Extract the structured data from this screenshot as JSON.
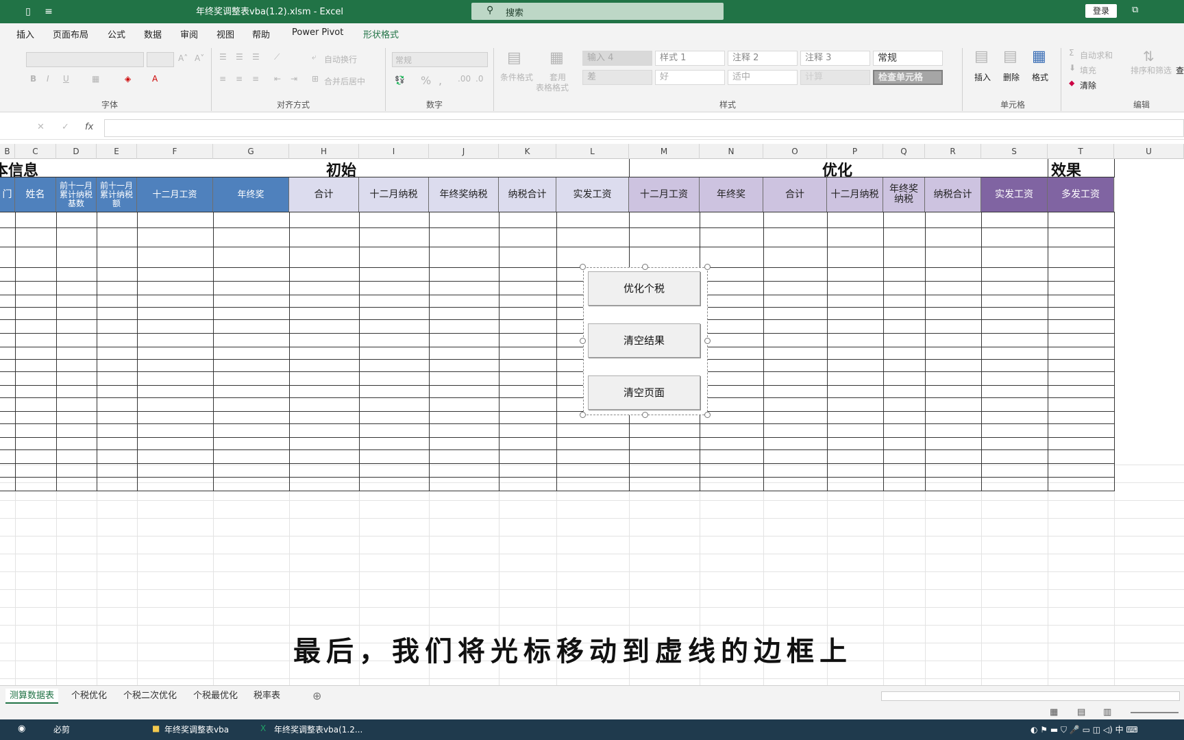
{
  "titlebar": {
    "doc_title": "年终奖调整表vba(1.2).xlsm  -  Excel",
    "search_placeholder": "搜索",
    "login": "登录"
  },
  "menu": [
    "插入",
    "页面布局",
    "公式",
    "数据",
    "审阅",
    "视图",
    "帮助",
    "Power Pivot",
    "形状格式"
  ],
  "ribbon": {
    "font_group": "字体",
    "align_group": "对齐方式",
    "number_group": "数字",
    "styles_group": "样式",
    "cells_group": "单元格",
    "edit_group": "编辑",
    "wrap_text": "自动换行",
    "merge_center": "合并后居中",
    "number_format": "常规",
    "cond_format": "条件格式",
    "table_format_1": "套用",
    "table_format_2": "表格格式",
    "styles": [
      {
        "label": "输入 4",
        "bg": "#d9d9d9"
      },
      {
        "label": "样式 1",
        "bg": "#ffffff"
      },
      {
        "label": "注释 2",
        "bg": "#ffffff"
      },
      {
        "label": "注释 3",
        "bg": "#ffffff"
      },
      {
        "label": "常规",
        "bg": "#ffffff"
      },
      {
        "label": "差",
        "bg": "#e6e6e6"
      },
      {
        "label": "好",
        "bg": "#ffffff"
      },
      {
        "label": "适中",
        "bg": "#ffffff"
      },
      {
        "label": "计算",
        "bg": "#e6e6e6"
      },
      {
        "label": "检查单元格",
        "bg": "#a6a6a6"
      }
    ],
    "insert": "插入",
    "delete": "删除",
    "format": "格式",
    "autosum": "自动求和",
    "fill": "填充",
    "clear": "清除",
    "sort_filter": "排序和筛选",
    "find": "查"
  },
  "columns": [
    "B",
    "C",
    "D",
    "E",
    "F",
    "G",
    "H",
    "I",
    "J",
    "K",
    "L",
    "M",
    "N",
    "O",
    "P",
    "Q",
    "R",
    "S",
    "T",
    "U"
  ],
  "sections": {
    "left": "本信息",
    "initial": "初始",
    "optimized": "优化",
    "effect": "效果"
  },
  "headers": [
    "门",
    "姓名",
    "前十一月累计纳税基数",
    "前十一月累计纳税额",
    "十二月工资",
    "年终奖",
    "合计",
    "十二月纳税",
    "年终奖纳税",
    "纳税合计",
    "实发工资",
    "十二月工资",
    "年终奖",
    "合计",
    "十二月纳税",
    "年终奖纳税",
    "纳税合计",
    "实发工资",
    "多发工资"
  ],
  "buttons": {
    "optimize": "优化个税",
    "clear_results": "清空结果",
    "clear_page": "清空页面"
  },
  "subtitle": "最后，我们将光标移动到虚线的边框上",
  "sheets": [
    "测算数据表",
    "个税优化",
    "个税二次优化",
    "个税最优化",
    "税率表"
  ],
  "taskbar": {
    "app1": "必剪",
    "app2": "年终奖调整表vba",
    "app3": "年终奖调整表vba(1.2..."
  }
}
